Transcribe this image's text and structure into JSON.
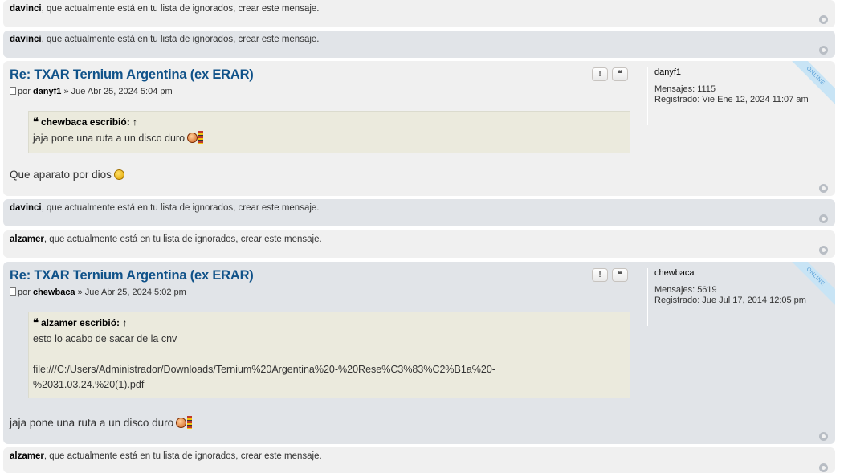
{
  "ignored_suffix": ", que actualmente está en tu lista de ignorados, crear este mensaje.",
  "ignored": [
    {
      "user": "davinci"
    },
    {
      "user": "davinci"
    },
    {
      "user": "davinci"
    },
    {
      "user": "alzamer"
    },
    {
      "user": "alzamer"
    }
  ],
  "posts": [
    {
      "title": "Re: TXAR Ternium Argentina (ex ERAR)",
      "meta_prefix": "por",
      "author": "danyf1",
      "date": "» Jue Abr 25, 2024 5:04 pm",
      "report_label": "!",
      "quote_label": "❝",
      "quote_cite": "chewbaca escribió: ↑",
      "quote_lines": [
        "jaja pone una ruta a un disco duro"
      ],
      "text": "Que aparato por dios",
      "profile": {
        "username": "danyf1",
        "mensajes": "Mensajes: 1115",
        "registrado": "Registrado: Vie Ene 12, 2024 11:07 am",
        "status": "ONLINE"
      }
    },
    {
      "title": "Re: TXAR Ternium Argentina (ex ERAR)",
      "meta_prefix": "por",
      "author": "chewbaca",
      "date": "» Jue Abr 25, 2024 5:02 pm",
      "report_label": "!",
      "quote_label": "❝",
      "quote_cite": "alzamer escribió: ↑",
      "quote_lines": [
        "esto lo acabo de sacar de la cnv",
        "",
        "file:///C:/Users/Administrador/Downloads/Ternium%20Argentina%20-%20Rese%C3%83%C2%B1a%20-",
        "%2031.03.24.%20(1).pdf"
      ],
      "text": "jaja pone una ruta a un disco duro",
      "profile": {
        "username": "chewbaca",
        "mensajes": "Mensajes: 5619",
        "registrado": "Registrado: Jue Jul 17, 2014 12:05 pm",
        "status": "ONLINE"
      }
    }
  ]
}
